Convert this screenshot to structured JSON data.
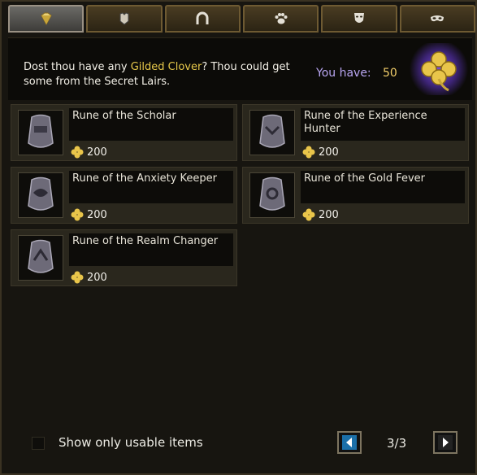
{
  "tabs": [
    {
      "icon": "gem-icon",
      "active": true
    },
    {
      "icon": "armor-icon",
      "active": false
    },
    {
      "icon": "horseshoe-icon",
      "active": false
    },
    {
      "icon": "paw-icon",
      "active": false
    },
    {
      "icon": "theater-mask-icon",
      "active": false
    },
    {
      "icon": "eye-mask-icon",
      "active": false
    }
  ],
  "header": {
    "text_pre": "Dost thou have any ",
    "text_highlight": "Gilded Clover",
    "text_post": "? Thou could get some from the Secret Lairs.",
    "you_have_label": "You have:",
    "you_have_value": "50"
  },
  "items": [
    {
      "title": "Rune of the Scholar",
      "price": "200"
    },
    {
      "title": "Rune of the Experience Hunter",
      "price": "200"
    },
    {
      "title": "Rune of the Anxiety Keeper",
      "price": "200"
    },
    {
      "title": "Rune of the Gold Fever",
      "price": "200"
    },
    {
      "title": "Rune of the Realm Changer",
      "price": "200"
    }
  ],
  "footer": {
    "filter_label": "Show only usable items",
    "page": "3/3"
  },
  "colors": {
    "accent_gold": "#e8c94a",
    "you_have_purple": "#b9a6f2"
  }
}
